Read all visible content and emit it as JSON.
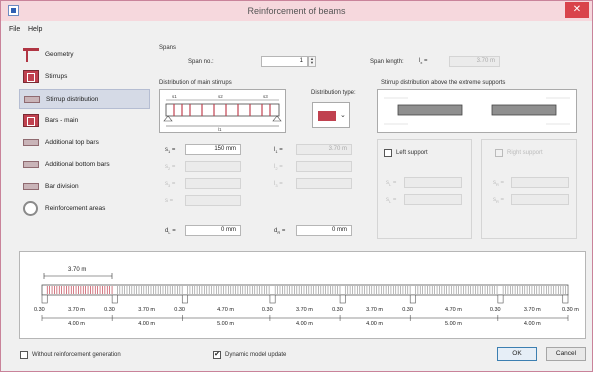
{
  "window": {
    "title": "Reinforcement of beams"
  },
  "menu": {
    "file": "File",
    "help": "Help"
  },
  "sidebar": {
    "items": [
      {
        "label": "Geometry",
        "icon": "geometry-icon"
      },
      {
        "label": "Stirrups",
        "icon": "stirrups-icon"
      },
      {
        "label": "Stirrup distribution",
        "icon": "stirrup-distribution-icon",
        "selected": true
      },
      {
        "label": "Bars - main",
        "icon": "bars-main-icon"
      },
      {
        "label": "Additional top bars",
        "icon": "additional-top-bars-icon"
      },
      {
        "label": "Additional bottom bars",
        "icon": "additional-bottom-bars-icon"
      },
      {
        "label": "Bar division",
        "icon": "bar-division-icon"
      },
      {
        "label": "Reinforcement areas",
        "icon": "reinforcement-areas-icon"
      }
    ]
  },
  "spans": {
    "group_label": "Spans",
    "span_no_label": "Span no.:",
    "span_no_value": "1",
    "span_length_label": "Span length:",
    "lx_label": "l",
    "lx_sub": "x",
    "lx_eq": "=",
    "lx_value": "3.70 m"
  },
  "main_stirrups": {
    "group_label": "Distribution of main stirrups",
    "distribution_type_label": "Distribution type:",
    "diagram_labels": {
      "a1": "s1",
      "a2": "s2",
      "a3": "s3",
      "l": "l1"
    },
    "left_fields": [
      {
        "label": "s",
        "sub": "1",
        "value": "150 mm",
        "enabled": true
      },
      {
        "label": "s",
        "sub": "2",
        "value": "",
        "enabled": false
      },
      {
        "label": "s",
        "sub": "3",
        "value": "",
        "enabled": false
      },
      {
        "label": "s",
        "sub": "",
        "value": "",
        "enabled": false
      }
    ],
    "right_fields": [
      {
        "label": "l",
        "sub": "1",
        "value": "3.70 m",
        "enabled": false
      },
      {
        "label": "l",
        "sub": "2",
        "value": "",
        "enabled": false
      },
      {
        "label": "l",
        "sub": "3",
        "value": "",
        "enabled": false
      }
    ],
    "dl_label": "d",
    "dl_sub": "L",
    "dl_value": "0 mm",
    "dr_label": "d",
    "dr_sub": "R",
    "dr_value": "0 mm"
  },
  "extreme_supports": {
    "group_label": "Stirrup distribution above the extreme supports",
    "left_support_label": "Left support",
    "right_support_label": "Right support",
    "left_fields": [
      {
        "label": "s",
        "sub": "L"
      },
      {
        "label": "s",
        "sub": "L"
      }
    ],
    "right_fields": [
      {
        "label": "s",
        "sub": "R"
      },
      {
        "label": "s",
        "sub": "R"
      }
    ]
  },
  "beam_overview": {
    "top_dim": "3.70 m",
    "spans": [
      {
        "left_cover": "0.30",
        "clear": "3.70 m",
        "total": "4.00 m"
      },
      {
        "left_cover": "0.30",
        "clear": "3.70 m",
        "total": "4.00 m"
      },
      {
        "left_cover": "0.30",
        "clear": "4.70 m",
        "total": "5.00 m"
      },
      {
        "left_cover": "0.30",
        "clear": "3.70 m",
        "total": "4.00 m"
      },
      {
        "left_cover": "0.30",
        "clear": "3.70 m",
        "total": "4.00 m"
      },
      {
        "left_cover": "0.30",
        "clear": "4.70 m",
        "total": "5.00 m"
      },
      {
        "left_cover": "0.30",
        "clear": "3.70 m",
        "total": "4.00 m"
      }
    ],
    "end_label": "0.30 m",
    "unit_m": "m"
  },
  "footer": {
    "without_reinforcement_label": "Without reinforcement generation",
    "dynamic_update_label": "Dynamic model update",
    "dynamic_update_checked": "✔",
    "ok_label": "OK",
    "cancel_label": "Cancel"
  },
  "colors": {
    "accent": "#c0414f",
    "titlebar": "#f6d8dd",
    "close": "#d9434b"
  }
}
